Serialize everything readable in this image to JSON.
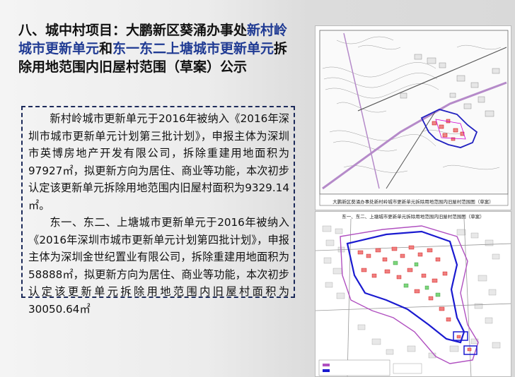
{
  "title": {
    "part1": "八、城中村项目：大鹏新区葵涌办事处",
    "part2": "新村岭城市更新单元",
    "part3": "和",
    "part4": "东一东二上塘城市更新单元",
    "part5": "拆除用地范围内旧屋村范围（草案）公示"
  },
  "body": {
    "paragraph1": "新村岭城市更新单元于2016年被纳入《2016年深圳市城市更新单元计划第三批计划》，申报主体为深圳市英博房地产开发有限公司，拆除重建用地面积为97927㎡，拟更新方向为居住、商业等功能，本次初步认定该更新单元拆除用地范围内旧屋村面积为9329.14㎡。",
    "paragraph2": "东一、东二、上塘城市更新单元于2016年被纳入《2016年深圳市城市更新单元计划第四批计划》，申报主体为深圳金世纪置业有限公司，拆除重建用地面积为58888㎡，拟更新方向为居住、商业等功能，本次初步认定该更新单元拆除用地范围内旧屋村面积为30050.64㎡"
  },
  "maps": {
    "map1_caption": "大鹏新区葵涌办事处新村岭城市更新单元拆除用地范围内旧屋村范围图（草案）",
    "map2_caption": "东一、东二、上塘城市更新单元拆除用地范围内旧屋村范围图（草案）"
  }
}
